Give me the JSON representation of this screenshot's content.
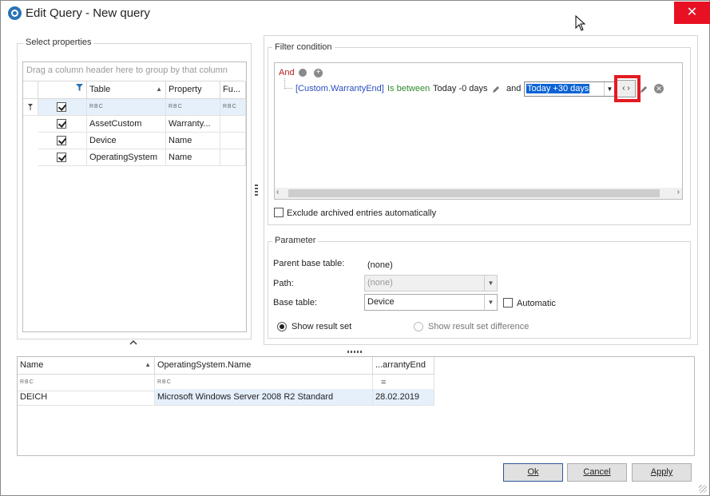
{
  "window": {
    "title": "Edit Query - New query",
    "close_glyph": "✕"
  },
  "select_properties": {
    "label": "Select properties",
    "group_hint": "Drag a column header here to group by that column",
    "columns": {
      "table": "Table",
      "property": "Property",
      "function": "Fu..."
    },
    "filter_row_glyph": "RBC",
    "rows": [
      {
        "checked": true,
        "table": "AssetCustom",
        "property": "Warranty..."
      },
      {
        "checked": true,
        "table": "Device",
        "property": "Name"
      },
      {
        "checked": true,
        "table": "OperatingSystem",
        "property": "Name"
      }
    ]
  },
  "filter": {
    "label": "Filter condition",
    "root_operator": "And",
    "field": "[Custom.WarrantyEnd]",
    "operator": "Is between",
    "value1": "Today -0 days",
    "conjunction": "and",
    "value2": "Today +30 days",
    "exclude_archived_label": "Exclude archived entries automatically",
    "exclude_archived_checked": false
  },
  "parameter": {
    "label": "Parameter",
    "parent_base_label": "Parent base table:",
    "parent_base_value": "(none)",
    "path_label": "Path:",
    "path_value": "(none)",
    "base_table_label": "Base table:",
    "base_table_value": "Device",
    "automatic_label": "Automatic",
    "automatic_checked": false,
    "show_result_label": "Show result set",
    "show_diff_label": "Show result set difference",
    "selected_mode": "show_result"
  },
  "results": {
    "columns": {
      "name": "Name",
      "os": "OperatingSystem.Name",
      "warranty": "...arrantyEnd"
    },
    "filter_glyph": "RBC",
    "filter_eq": "=",
    "rows": [
      {
        "name": "DEICH",
        "os": "Microsoft Windows Server 2008 R2 Standard",
        "warranty": "28.02.2019"
      }
    ]
  },
  "buttons": {
    "ok": "Ok",
    "cancel": "Cancel",
    "apply": "Apply"
  },
  "colors": {
    "accent": "#2a73b8",
    "operator": "#b22222",
    "field": "#2b4fc0",
    "condition": "#2e8b2e",
    "highlight": "#e21b23",
    "selection": "#0b63d6"
  }
}
